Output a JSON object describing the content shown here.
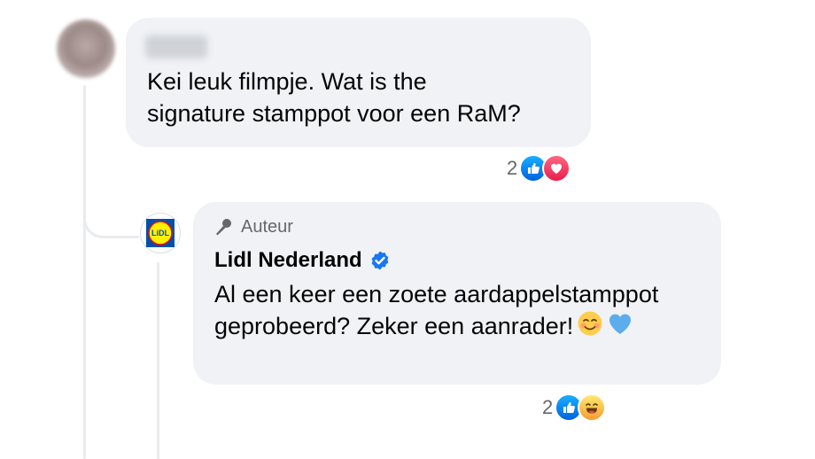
{
  "comment": {
    "text": "Kei leuk filmpje. Wat is the\nsignature stamppot voor een RaM?",
    "reactions": {
      "count": "2",
      "types": [
        "like-icon",
        "love-icon"
      ]
    }
  },
  "reply": {
    "badge": "Auteur",
    "author": "Lidl Nederland",
    "logo_text": "LiDL",
    "text": "Al een keer een zoete aardappelstamppot\ngeprobeerd? Zeker een aanrader!",
    "emojis": [
      "smiling-face-icon",
      "blue-heart-icon"
    ],
    "reactions": {
      "count": "2",
      "types": [
        "like-icon",
        "haha-icon"
      ]
    }
  },
  "colors": {
    "bubble": "#f0f2f5",
    "secondary_text": "#65676b",
    "verified_blue": "#1877f2",
    "like_blue": "#0866ff",
    "love_red": "#f33e58",
    "lidl_blue": "#0050aa",
    "lidl_yellow": "#fff000",
    "lidl_red": "#e60a14"
  }
}
